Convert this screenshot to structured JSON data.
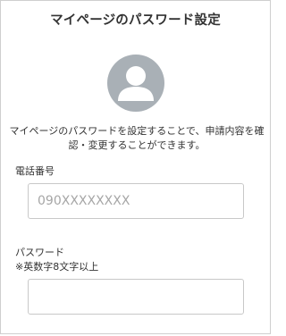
{
  "page": {
    "title": "マイページのパスワード設定",
    "description": "マイページのパスワードを設定することで、申請内容を確認・変更することができます。"
  },
  "phone": {
    "label": "電話番号",
    "placeholder": "090XXXXXXXX",
    "value": ""
  },
  "password": {
    "label": "パスワード",
    "hint": "※英数字8文字以上",
    "value": ""
  },
  "avatar": {
    "icon": "user-icon",
    "color": "#a9b0b6"
  }
}
